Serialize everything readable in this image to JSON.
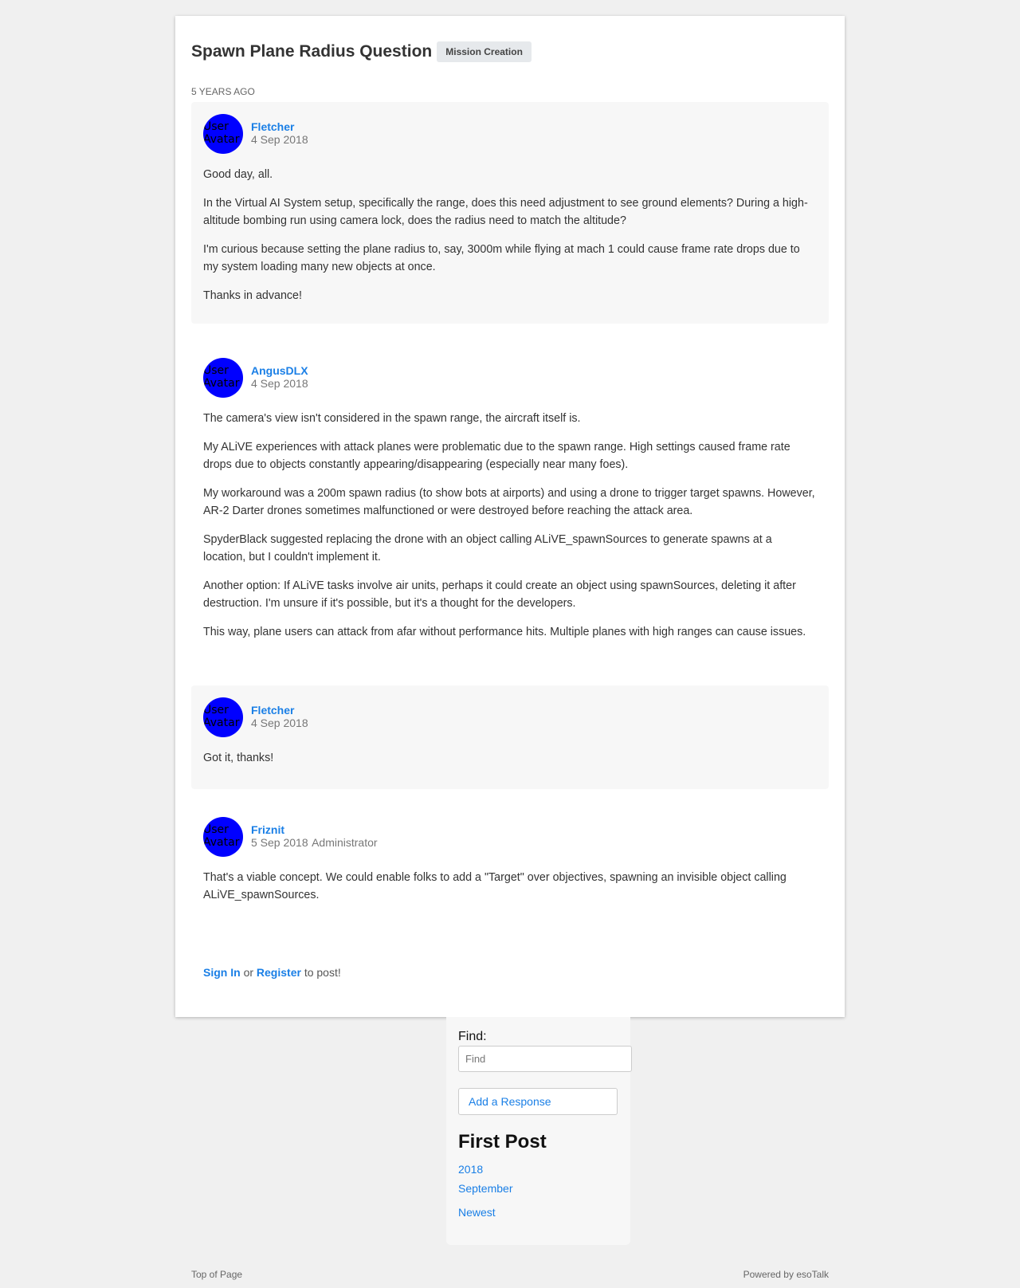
{
  "topic": {
    "title": "Spawn Plane Radius Question",
    "tag": "Mission Creation",
    "age": "5 years ago"
  },
  "avatar_alt": "User Avatar",
  "posts": [
    {
      "author": "Fletcher",
      "date": "4 Sep 2018",
      "role": "",
      "paragraphs": [
        "Good day, all.",
        "In the Virtual AI System setup, specifically the range, does this need adjustment to see ground elements? During a high-altitude bombing run using camera lock, does the radius need to match the altitude?",
        "I'm curious because setting the plane radius to, say, 3000m while flying at mach 1 could cause frame rate drops due to my system loading many new objects at once.",
        "Thanks in advance!"
      ]
    },
    {
      "author": "AngusDLX",
      "date": "4 Sep 2018",
      "role": "",
      "paragraphs": [
        "The camera's view isn't considered in the spawn range, the aircraft itself is.",
        "My ALiVE experiences with attack planes were problematic due to the spawn range. High settings caused frame rate drops due to objects constantly appearing/disappearing (especially near many foes).",
        "My workaround was a 200m spawn radius (to show bots at airports) and using a drone to trigger target spawns. However, AR-2 Darter drones sometimes malfunctioned or were destroyed before reaching the attack area.",
        "SpyderBlack suggested replacing the drone with an object calling ALiVE_spawnSources to generate spawns at a location, but I couldn't implement it.",
        "Another option: If ALiVE tasks involve air units, perhaps it could create an object using spawnSources, deleting it after destruction. I'm unsure if it's possible, but it's a thought for the developers.",
        "This way, plane users can attack from afar without performance hits. Multiple planes with high ranges can cause issues."
      ]
    },
    {
      "author": "Fletcher",
      "date": "4 Sep 2018",
      "role": "",
      "paragraphs": [
        "Got it, thanks!"
      ]
    },
    {
      "author": "Friznit",
      "date": "5 Sep 2018",
      "role": "Administrator",
      "paragraphs": [
        "That's a viable concept. We could enable folks to add a \"Target\" over objectives, spawning an invisible object calling ALiVE_spawnSources."
      ]
    }
  ],
  "reply_prompt": {
    "sign_in": "Sign In",
    "or": "or",
    "register": "Register",
    "suffix": "to post!"
  },
  "sidebar": {
    "find_label": "Find:",
    "find_placeholder": "Find",
    "add_response": "Add a Response",
    "heading": "First Post",
    "links": [
      "2018",
      "September",
      "Newest"
    ]
  },
  "footer": {
    "top": "Top of Page",
    "powered": "Powered by esoTalk"
  },
  "colors": {
    "link": "#1a7fe6",
    "avatar_bg": "#0000ff",
    "page_bg": "#f0f0f0"
  }
}
